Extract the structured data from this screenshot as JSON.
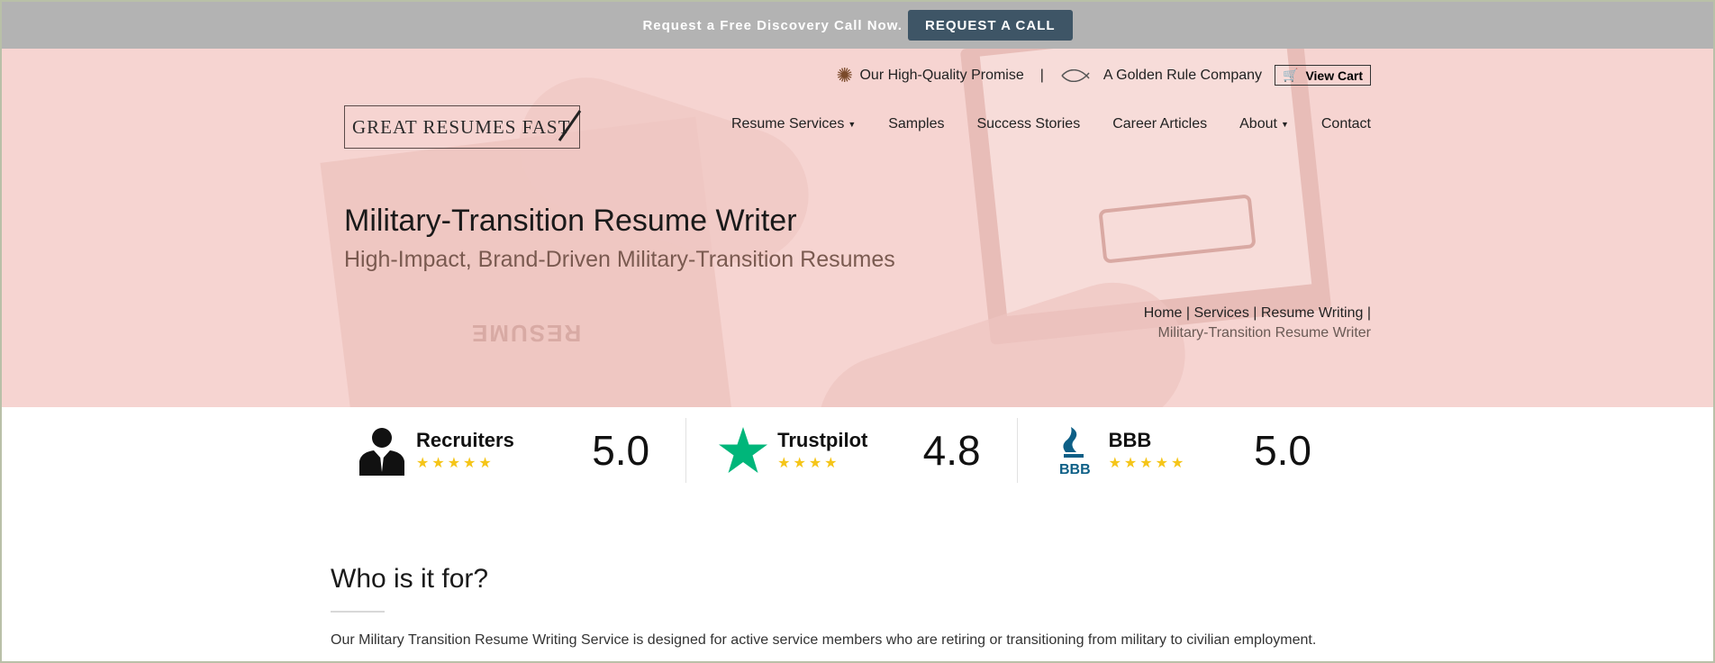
{
  "topbar": {
    "promo_text": "Request a Free Discovery Call Now.",
    "cta_label": "REQUEST A CALL"
  },
  "utility": {
    "promise": "Our High-Quality Promise",
    "separator": "|",
    "golden_rule": "A Golden Rule Company",
    "cart_label": "View Cart"
  },
  "logo": {
    "text": "GREAT RESUMES FAST"
  },
  "nav": {
    "items": [
      {
        "label": "Resume Services",
        "dropdown": true
      },
      {
        "label": "Samples",
        "dropdown": false
      },
      {
        "label": "Success Stories",
        "dropdown": false
      },
      {
        "label": "Career Articles",
        "dropdown": false
      },
      {
        "label": "About",
        "dropdown": true
      },
      {
        "label": "Contact",
        "dropdown": false
      }
    ]
  },
  "hero": {
    "title": "Military-Transition Resume Writer",
    "subtitle": "High-Impact, Brand-Driven Military-Transition Resumes",
    "background_word": "RESUME"
  },
  "breadcrumb": {
    "links": "Home | Services | Resume Writing |",
    "current": "Military-Transition Resume Writer"
  },
  "ratings": [
    {
      "name": "Recruiters",
      "stars": "★★★★★",
      "score": "5.0",
      "icon": "businessman-icon"
    },
    {
      "name": "Trustpilot",
      "stars": "★★★★",
      "score": "4.8",
      "icon": "trustpilot-star-icon"
    },
    {
      "name": "BBB",
      "stars": "★★★★★",
      "score": "5.0",
      "icon": "bbb-logo-icon"
    }
  ],
  "section": {
    "title": "Who is it for?",
    "text": "Our Military Transition Resume Writing Service is designed for active service members who are retiring or transitioning from military to civilian employment."
  },
  "colors": {
    "topbar_bg": "#b3b3b3",
    "cta_bg": "#3e5566",
    "hero_bg": "#f6d4d1",
    "star_color": "#f5c518",
    "trustpilot_green": "#00b67a",
    "bbb_blue": "#0d5f86"
  }
}
